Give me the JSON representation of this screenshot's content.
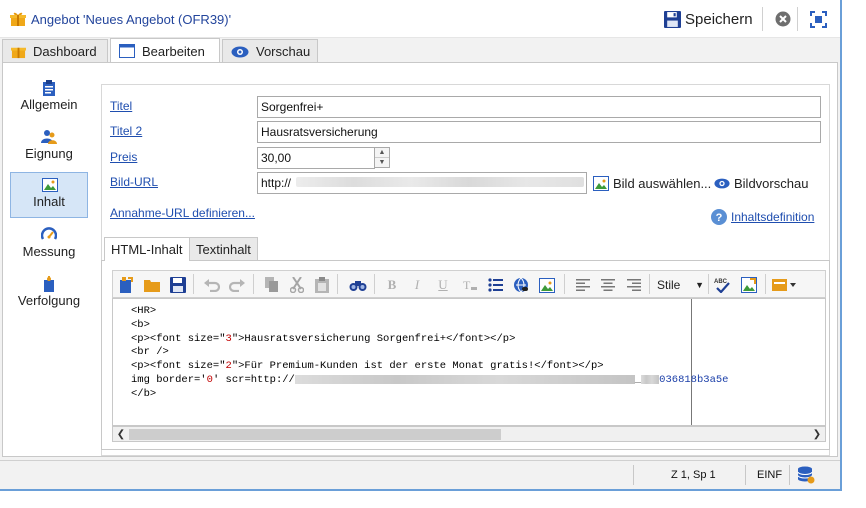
{
  "window": {
    "title": "Angebot 'Neues Angebot (OFR39)'",
    "save_label": "Speichern"
  },
  "tabs": [
    {
      "label": "Dashboard",
      "icon": "gift-icon"
    },
    {
      "label": "Bearbeiten",
      "icon": "window-icon",
      "active": true
    },
    {
      "label": "Vorschau",
      "icon": "eye-icon"
    }
  ],
  "sidebar": {
    "items": [
      {
        "label": "Allgemein",
        "icon": "clipboard-icon"
      },
      {
        "label": "Eignung",
        "icon": "users-icon"
      },
      {
        "label": "Inhalt",
        "icon": "image-icon",
        "active": true
      },
      {
        "label": "Messung",
        "icon": "gauge-icon"
      },
      {
        "label": "Verfolgung",
        "icon": "tracking-icon"
      }
    ]
  },
  "form": {
    "title_label": "Titel",
    "title_value": "Sorgenfrei+",
    "title2_label": "Titel 2",
    "title2_value": "Hausratsversicherung",
    "price_label": "Preis",
    "price_value": "30,00",
    "image_url_label": "Bild-URL",
    "image_url_value": "http://",
    "choose_image_label": "Bild auswählen...",
    "image_preview_label": "Bildvorschau",
    "accept_url_link": "Annahme-URL definieren...",
    "content_definition_link": "Inhaltsdefinition"
  },
  "editor": {
    "tabs": [
      "HTML-Inhalt",
      "Textinhalt"
    ],
    "style_label": "Stile",
    "code_lines": [
      "<HR>",
      "<b>",
      "<p><font size=\"3\">Hausratsversicherung Sorgenfrei+</font></p>",
      "<br />",
      "<p><font size=\"2\">Für Premium-Kunden ist der erste Monat gratis!</font></p>",
      "img border='0' scr=http://",
      "</b>"
    ],
    "code_line5_tail": "036818b3a5e"
  },
  "status": {
    "position": "Z 1, Sp 1",
    "mode": "EINF"
  },
  "colors": {
    "link": "#1f4eaf",
    "active_nav": "#d6e6f7",
    "window_border": "#6a9fd8"
  }
}
